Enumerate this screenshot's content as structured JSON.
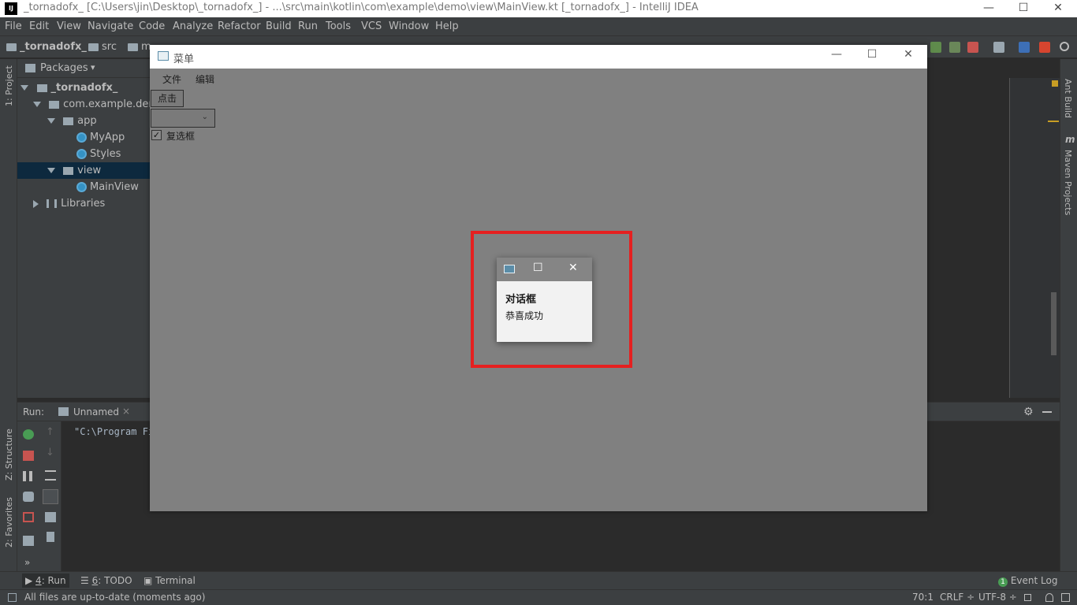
{
  "ide": {
    "title": "_tornadofx_ [C:\\Users\\jin\\Desktop\\_tornadofx_] - ...\\src\\main\\kotlin\\com\\example\\demo\\view\\MainView.kt [_tornadofx_] - IntelliJ IDEA",
    "logo_text": "IJ",
    "window_controls": {
      "minimize": "—",
      "maximize": "☐",
      "close": "✕"
    },
    "menu": [
      "File",
      "Edit",
      "View",
      "Navigate",
      "Code",
      "Analyze",
      "Refactor",
      "Build",
      "Run",
      "Tools",
      "VCS",
      "Window",
      "Help"
    ],
    "breadcrumbs": [
      "_tornadofx_",
      "src",
      "m"
    ],
    "project": {
      "header": "Packages",
      "dropdown_arrow": "▾",
      "tree": [
        {
          "label": "_tornadofx_",
          "bold": true
        },
        {
          "label": "com.example.demo"
        },
        {
          "label": "app"
        },
        {
          "label": "MyApp"
        },
        {
          "label": "Styles"
        },
        {
          "label": "view",
          "selected": true
        },
        {
          "label": "MainView"
        },
        {
          "label": "Libraries"
        }
      ]
    },
    "left_stripe": {
      "project": "1: Project",
      "structure": "Z: Structure",
      "favorites": "2: Favorites"
    },
    "right_stripe": {
      "ant": "Ant Build",
      "maven": "Maven Projects",
      "maven_glyph": "m"
    },
    "run": {
      "label": "Run:",
      "tab": "Unnamed",
      "tab_close": "×",
      "console_line": "\"C:\\Program Fi",
      "more": "»"
    },
    "bottom_tabs": [
      {
        "prefix": "4",
        "label": ": Run"
      },
      {
        "prefix": "6",
        "label": ": TODO"
      },
      {
        "prefix": "",
        "label": "Terminal"
      }
    ],
    "event_log": "Event Log",
    "event_log_count": "1",
    "status": {
      "message": "All files are up-to-date (moments ago)",
      "position": "70:1",
      "line_sep": "CRLF ÷",
      "encoding": "UTF-8 ÷"
    }
  },
  "app": {
    "title": "菜单",
    "controls": {
      "minimize": "—",
      "maximize": "☐",
      "close": "✕"
    },
    "menus": [
      "文件",
      "编辑"
    ],
    "button_label": "点击",
    "combo_chevron": "⌄",
    "checkbox_label": "复选框",
    "checkbox_checked": true,
    "checkbox_mark": "✓"
  },
  "dialog": {
    "controls": {
      "maximize": "☐",
      "close": "✕"
    },
    "header": "对话框",
    "message": "恭喜成功"
  },
  "colors": {
    "ide_bg": "#2b2b2b",
    "panel_bg": "#3c3f41",
    "selection": "#0d293e",
    "app_content_bg": "#808080",
    "highlight": "#e52020",
    "dialog_titlebar": "#858585"
  }
}
